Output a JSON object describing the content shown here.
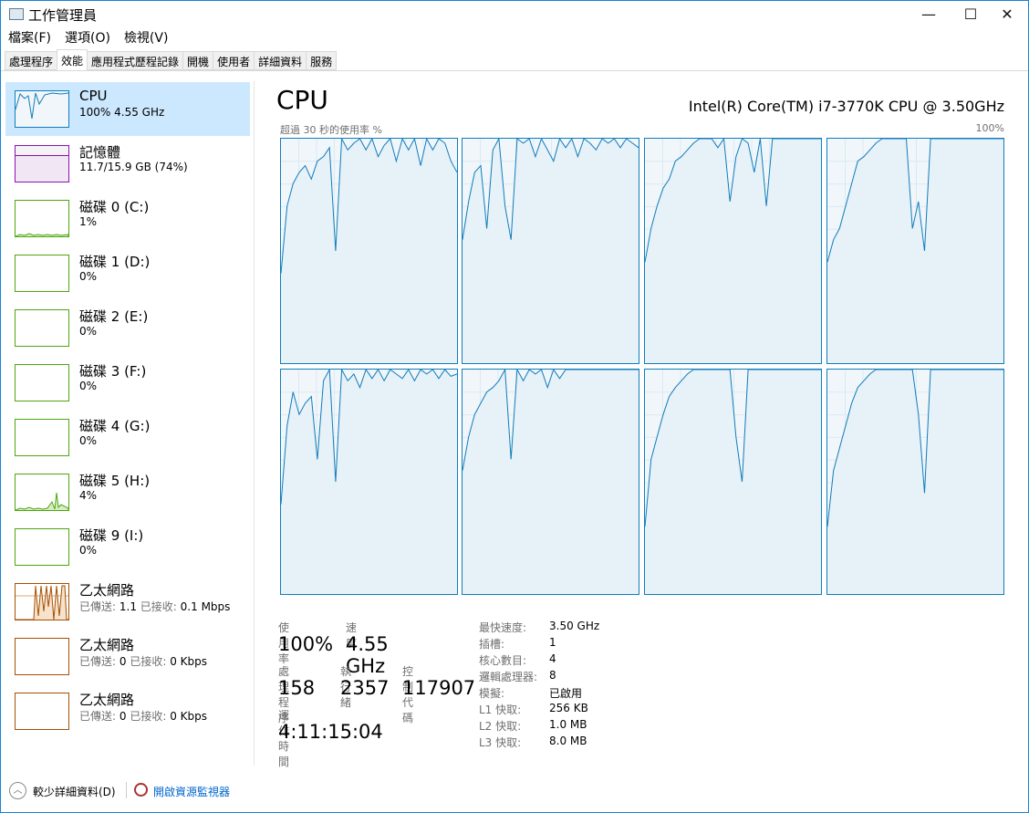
{
  "window": {
    "title": "工作管理員",
    "min": "—",
    "max": "☐",
    "close": "✕"
  },
  "menu": [
    "檔案(F)",
    "選項(O)",
    "檢視(V)"
  ],
  "tabs": [
    "處理程序",
    "效能",
    "應用程式歷程記錄",
    "開機",
    "使用者",
    "詳細資料",
    "服務"
  ],
  "active_tab": 1,
  "sidebar": [
    {
      "name": "CPU",
      "sub": "100% 4.55 GHz",
      "color": "#117dbb",
      "selected": true
    },
    {
      "name": "記憶體",
      "sub": "11.7/15.9 GB (74%)",
      "color": "#8b12ae"
    },
    {
      "name": "磁碟 0 (C:)",
      "sub": "1%",
      "color": "#4da60c"
    },
    {
      "name": "磁碟 1 (D:)",
      "sub": "0%",
      "color": "#4da60c"
    },
    {
      "name": "磁碟 2 (E:)",
      "sub": "0%",
      "color": "#4da60c"
    },
    {
      "name": "磁碟 3 (F:)",
      "sub": "0%",
      "color": "#4da60c"
    },
    {
      "name": "磁碟 4 (G:)",
      "sub": "0%",
      "color": "#4da60c"
    },
    {
      "name": "磁碟 5 (H:)",
      "sub": "4%",
      "color": "#4da60c"
    },
    {
      "name": "磁碟 9 (I:)",
      "sub": "0%",
      "color": "#4da60c"
    },
    {
      "name": "乙太網路",
      "sent_lbl": "已傳送:",
      "sent": "1.1",
      "recv_lbl": "已接收:",
      "recv": "0.1 Mbps",
      "color": "#a74f01"
    },
    {
      "name": "乙太網路",
      "sent_lbl": "已傳送:",
      "sent": "0",
      "recv_lbl": "已接收:",
      "recv": "0 Kbps",
      "color": "#a74f01"
    },
    {
      "name": "乙太網路",
      "sent_lbl": "已傳送:",
      "sent": "0",
      "recv_lbl": "已接收:",
      "recv": "0 Kbps",
      "color": "#a74f01"
    }
  ],
  "main": {
    "title": "CPU",
    "model": "Intel(R) Core(TM) i7-3770K CPU @ 3.50GHz",
    "graph_label": "超過 30 秒的使用率 %",
    "graph_max": "100%",
    "cores": [
      [
        40,
        70,
        80,
        85,
        88,
        82,
        90,
        92,
        96,
        50,
        100,
        95,
        98,
        100,
        95,
        100,
        92,
        97,
        100,
        90,
        100,
        95,
        100,
        88,
        100,
        95,
        100,
        98,
        90,
        85
      ],
      [
        55,
        72,
        85,
        88,
        60,
        95,
        100,
        70,
        55,
        100,
        98,
        100,
        92,
        100,
        95,
        90,
        100,
        96,
        100,
        92,
        100,
        98,
        95,
        100,
        98,
        100,
        96,
        100,
        98,
        96
      ],
      [
        45,
        60,
        70,
        78,
        82,
        90,
        92,
        95,
        98,
        100,
        100,
        100,
        96,
        100,
        72,
        92,
        100,
        98,
        85,
        100,
        70,
        100,
        100,
        100,
        100,
        100,
        100,
        100,
        100,
        100
      ],
      [
        45,
        55,
        60,
        70,
        80,
        90,
        92,
        95,
        98,
        100,
        100,
        100,
        100,
        100,
        60,
        72,
        50,
        100,
        100,
        100,
        100,
        100,
        100,
        100,
        100,
        100,
        100,
        100,
        100,
        100
      ],
      [
        40,
        75,
        90,
        80,
        85,
        88,
        60,
        95,
        100,
        50,
        100,
        95,
        98,
        92,
        100,
        96,
        100,
        95,
        100,
        98,
        96,
        100,
        95,
        100,
        98,
        100,
        96,
        100,
        97,
        98
      ],
      [
        55,
        70,
        80,
        85,
        90,
        92,
        95,
        100,
        60,
        100,
        95,
        100,
        98,
        100,
        92,
        100,
        96,
        100,
        100,
        100,
        100,
        100,
        100,
        100,
        100,
        100,
        100,
        100,
        100,
        100
      ],
      [
        30,
        60,
        70,
        80,
        88,
        92,
        95,
        98,
        100,
        100,
        100,
        100,
        100,
        100,
        100,
        70,
        50,
        100,
        100,
        100,
        100,
        100,
        100,
        100,
        100,
        100,
        100,
        100,
        100,
        100
      ],
      [
        30,
        55,
        65,
        75,
        85,
        92,
        95,
        98,
        100,
        100,
        100,
        100,
        100,
        100,
        100,
        80,
        45,
        100,
        100,
        100,
        100,
        100,
        100,
        100,
        100,
        100,
        100,
        100,
        100,
        100
      ]
    ],
    "stats": {
      "usage_lbl": "使用率",
      "usage": "100%",
      "speed_lbl": "速度",
      "speed": "4.55 GHz",
      "proc_lbl": "處理程序",
      "proc": "158",
      "thr_lbl": "執行緒",
      "thr": "2357",
      "handle_lbl": "控制代碼",
      "handle": "117907",
      "uptime_lbl": "運作時間",
      "uptime": "4:11:15:04"
    },
    "specs": [
      [
        "最快速度:",
        "3.50 GHz"
      ],
      [
        "插槽:",
        "1"
      ],
      [
        "核心數目:",
        "4"
      ],
      [
        "邏輯處理器:",
        "8"
      ],
      [
        "模擬:",
        "已啟用"
      ],
      [
        "L1 快取:",
        "256 KB"
      ],
      [
        "L2 快取:",
        "1.0 MB"
      ],
      [
        "L3 快取:",
        "8.0 MB"
      ]
    ]
  },
  "footer": {
    "less": "較少詳細資料(D)",
    "monitor": "開啟資源監視器"
  }
}
